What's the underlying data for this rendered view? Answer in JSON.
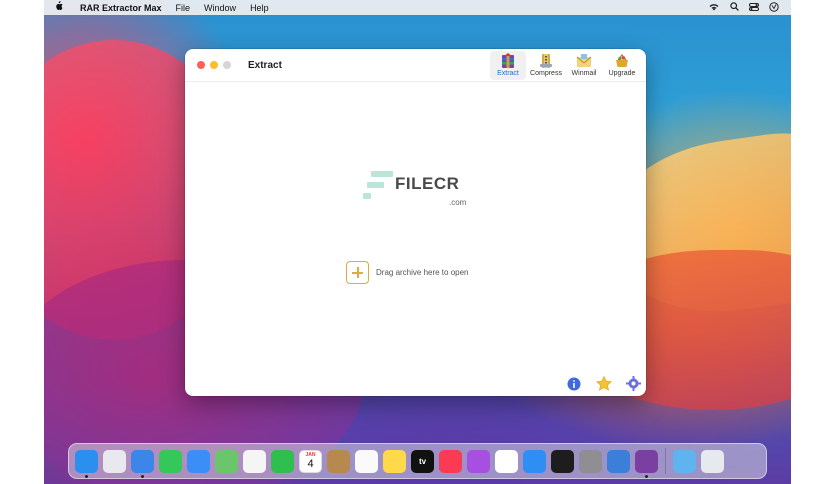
{
  "menubar": {
    "apple": "",
    "app_name": "RAR Extractor Max",
    "items": [
      "File",
      "Window",
      "Help"
    ]
  },
  "window": {
    "title": "Extract",
    "toolbar": [
      {
        "label": "Extract",
        "active": true
      },
      {
        "label": "Compress",
        "active": false
      },
      {
        "label": "Winmail",
        "active": false
      },
      {
        "label": "Upgrade",
        "active": false
      }
    ],
    "watermark": {
      "text": "FILECR",
      "suffix": ".com"
    },
    "drop_hint": "Drag archive here to open",
    "bottom_icons": [
      "info-icon",
      "star-icon",
      "gear-icon"
    ]
  },
  "dock": {
    "apps": [
      {
        "name": "finder",
        "color": "#2b8ff0"
      },
      {
        "name": "launchpad",
        "color": "#e8e8ee"
      },
      {
        "name": "safari",
        "color": "#3b86e8"
      },
      {
        "name": "messages",
        "color": "#34c759"
      },
      {
        "name": "mail",
        "color": "#3a8ef6"
      },
      {
        "name": "maps",
        "color": "#6bc66b"
      },
      {
        "name": "photos",
        "color": "#f5f5f5"
      },
      {
        "name": "facetime",
        "color": "#2fbf4e"
      },
      {
        "name": "calendar",
        "color": "#ffffff"
      },
      {
        "name": "contacts",
        "color": "#b8894e"
      },
      {
        "name": "reminders",
        "color": "#fafafa"
      },
      {
        "name": "notes",
        "color": "#ffd94a"
      },
      {
        "name": "apple-tv",
        "color": "#111111"
      },
      {
        "name": "music",
        "color": "#fa3b53"
      },
      {
        "name": "podcasts",
        "color": "#a74fe0"
      },
      {
        "name": "news",
        "color": "#ffffff"
      },
      {
        "name": "app-store",
        "color": "#2f8ef4"
      },
      {
        "name": "terminal",
        "color": "#1d1d1d"
      },
      {
        "name": "system-preferences",
        "color": "#8e8e93"
      },
      {
        "name": "altimeter",
        "color": "#3b7fd8"
      },
      {
        "name": "rar-extractor",
        "color": "#7a3fa0"
      },
      {
        "name": "downloads-folder",
        "color": "#5fb4ef"
      },
      {
        "name": "trash",
        "color": "#e6e9ee"
      }
    ],
    "calendar_month": "JAN",
    "calendar_day": "4",
    "tv_label": "tv"
  }
}
